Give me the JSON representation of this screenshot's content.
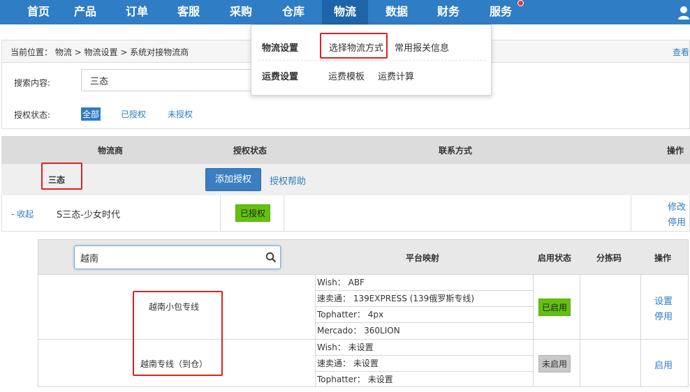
{
  "nav": {
    "items": [
      "首页",
      "产品",
      "订单",
      "客服",
      "采购",
      "仓库",
      "物流",
      "数据",
      "财务",
      "服务"
    ],
    "active": "物流"
  },
  "dropdown": {
    "group1_title": "物流设置",
    "group1_items": [
      "选择物流方式",
      "常用报关信息"
    ],
    "group2_title": "运费设置",
    "group2_items": [
      "运费模板",
      "运费计算"
    ]
  },
  "breadcrumb": {
    "text": "当前位置：  物流 >  物流设置 > 系统对接物流商",
    "right_link": "查看"
  },
  "filter": {
    "search_label": "搜索内容:",
    "search_value": "三态",
    "auth_label": "授权状态:",
    "auth_options": [
      "全部",
      "已授权",
      "未授权"
    ],
    "auth_selected": "全部"
  },
  "table": {
    "headers": [
      "物流商",
      "授权状态",
      "联系方式",
      "操作"
    ],
    "group_name": "三态",
    "add_auth_button": "添加授权",
    "auth_help_link": "授权帮助",
    "vendor": {
      "collapse_label": "- 收起",
      "name": "S三态-少女时代",
      "status": "已授权",
      "actions": [
        "修改",
        "停用"
      ]
    }
  },
  "subtable": {
    "search_value": "越南",
    "headers": [
      "平台映射",
      "启用状态",
      "分拣码",
      "操作"
    ],
    "rows": [
      {
        "name": "越南小包专线",
        "mappings": [
          "Wish：  ABF",
          "速卖通：  139EXPRESS (139俄罗斯专线)",
          "Tophatter：  4px",
          "Mercado：  360LION"
        ],
        "status": "已启用",
        "actions": [
          "设置",
          "停用"
        ]
      },
      {
        "name": "越南专线（到仓）",
        "mappings": [
          "Wish：  未设置",
          "速卖通：  未设置",
          "Tophatter：  未设置"
        ],
        "status": "未启用",
        "actions": [
          "启用"
        ]
      }
    ]
  },
  "colors": {
    "nav_bg": "#2f7dc4",
    "nav_active": "#1e64a8",
    "link": "#2f7dc4",
    "badge_green": "#63c20c",
    "highlight_red": "#e02020"
  }
}
